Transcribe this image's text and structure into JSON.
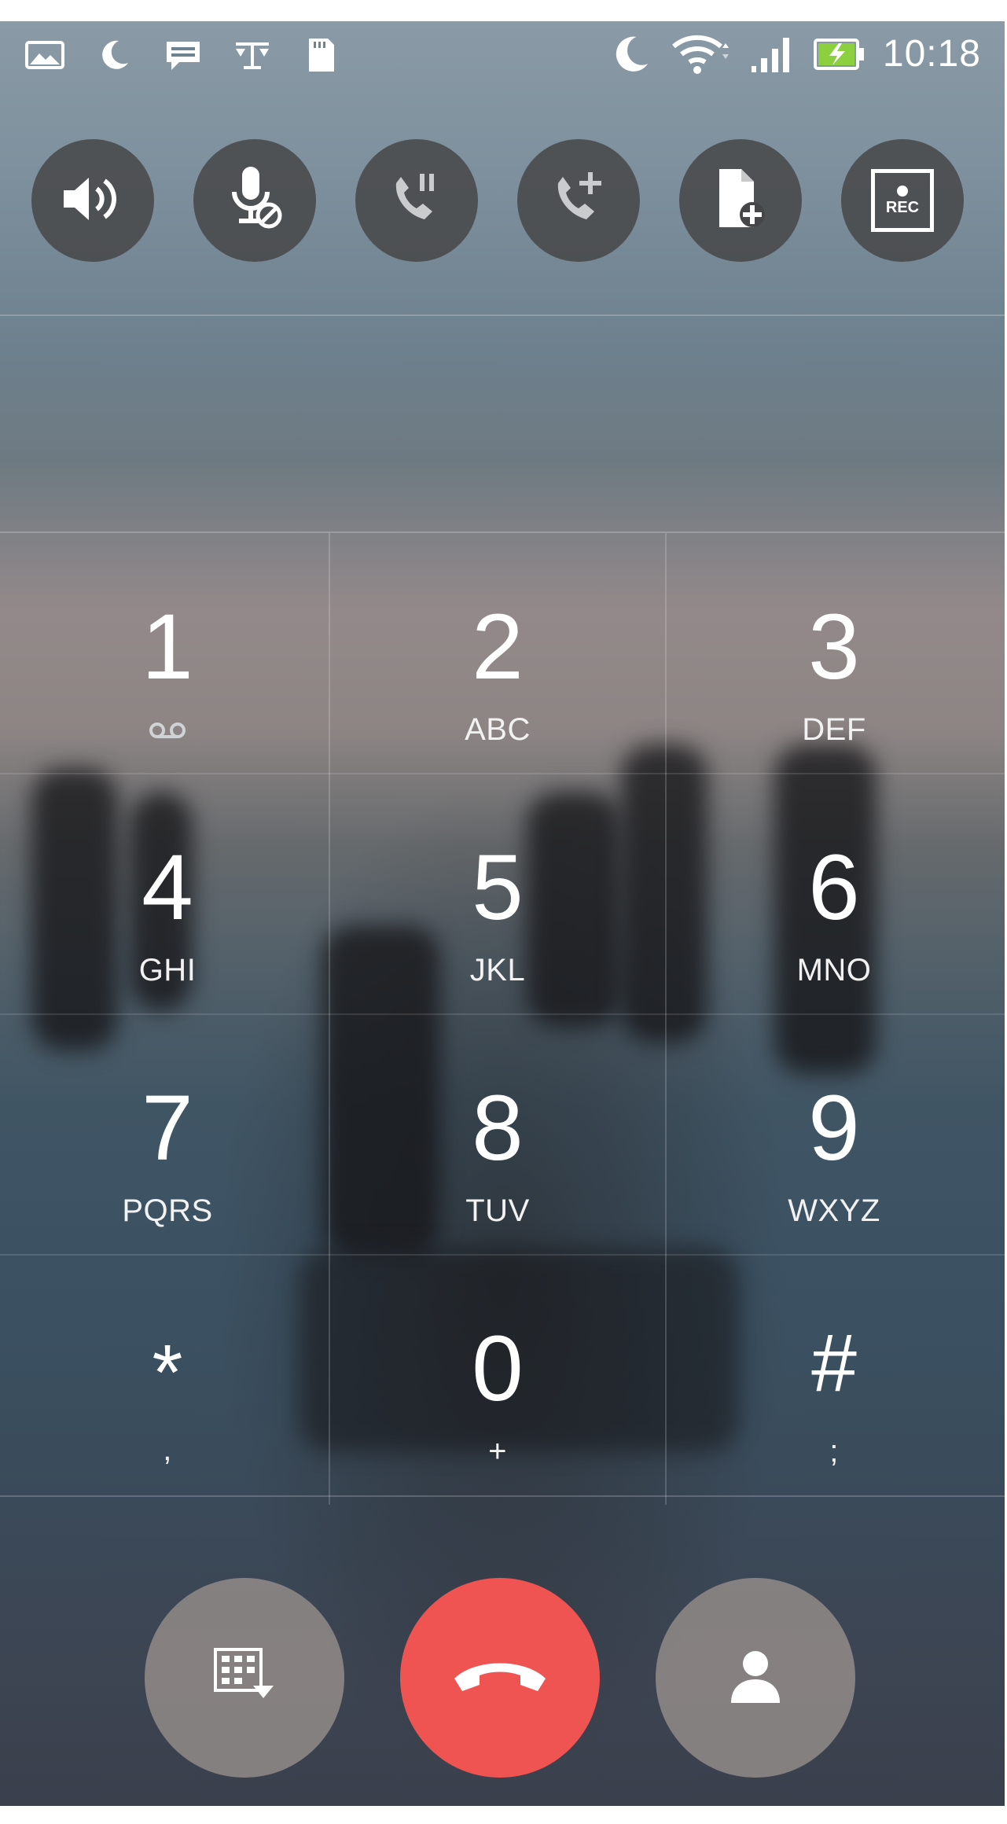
{
  "status_bar": {
    "time": "10:18",
    "left_icons": [
      "gallery-icon",
      "moon-icon",
      "message-icon",
      "scale-icon",
      "sd-card-icon"
    ],
    "right_icons": [
      "moon-icon",
      "wifi-icon",
      "signal-icon",
      "battery-charging-icon"
    ]
  },
  "call_actions": [
    {
      "name": "speaker-button",
      "icon": "speaker-icon"
    },
    {
      "name": "mute-button",
      "icon": "mic-off-icon"
    },
    {
      "name": "hold-button",
      "icon": "phone-hold-icon"
    },
    {
      "name": "add-call-button",
      "icon": "phone-add-icon"
    },
    {
      "name": "add-note-button",
      "icon": "note-add-icon"
    },
    {
      "name": "record-button",
      "icon": "record-icon",
      "label": "REC"
    }
  ],
  "dialpad": {
    "keys": [
      {
        "digit": "1",
        "sub": "",
        "sub_icon": "voicemail-icon"
      },
      {
        "digit": "2",
        "sub": "ABC"
      },
      {
        "digit": "3",
        "sub": "DEF"
      },
      {
        "digit": "4",
        "sub": "GHI"
      },
      {
        "digit": "5",
        "sub": "JKL"
      },
      {
        "digit": "6",
        "sub": "MNO"
      },
      {
        "digit": "7",
        "sub": "PQRS"
      },
      {
        "digit": "8",
        "sub": "TUV"
      },
      {
        "digit": "9",
        "sub": "WXYZ"
      },
      {
        "digit": "*",
        "sub": ","
      },
      {
        "digit": "0",
        "sub": "+"
      },
      {
        "digit": "#",
        "sub": ";"
      }
    ]
  },
  "bottom_controls": [
    {
      "name": "hide-dialpad-button",
      "icon": "dialpad-hide-icon"
    },
    {
      "name": "end-call-button",
      "icon": "phone-hangup-icon"
    },
    {
      "name": "contacts-button",
      "icon": "person-icon"
    }
  ],
  "colors": {
    "end_call": "#ef5352",
    "action_button": "#464648",
    "bottom_button": "#8c8684"
  }
}
